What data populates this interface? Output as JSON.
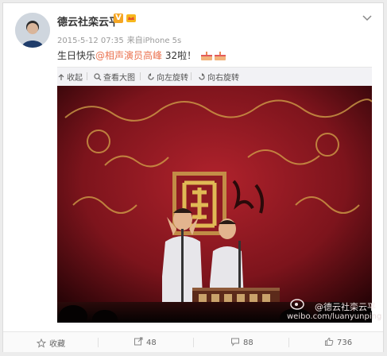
{
  "post": {
    "author": "德云社栾云平",
    "verified_badge": "V",
    "timestamp": "2015-5-12 07:35",
    "source_prefix": "来自",
    "source": "iPhone 5s",
    "text_before": "生日快乐",
    "mention": "@相声演员高峰",
    "text_after": " 32啦！"
  },
  "toolbar": {
    "collapse": "收起",
    "view_large": "查看大图",
    "rotate_left": "向左旋转",
    "rotate_right": "向右旋转"
  },
  "image_watermark": {
    "name": "@德云社栾云平",
    "url": "weibo.com/luanyunping"
  },
  "footer": {
    "favorite": "收藏",
    "reposts": "48",
    "comments": "88",
    "likes": "736"
  },
  "colors": {
    "mention": "#eb7350",
    "verified": "#f5a623",
    "stage_red": "#8e1a22"
  }
}
